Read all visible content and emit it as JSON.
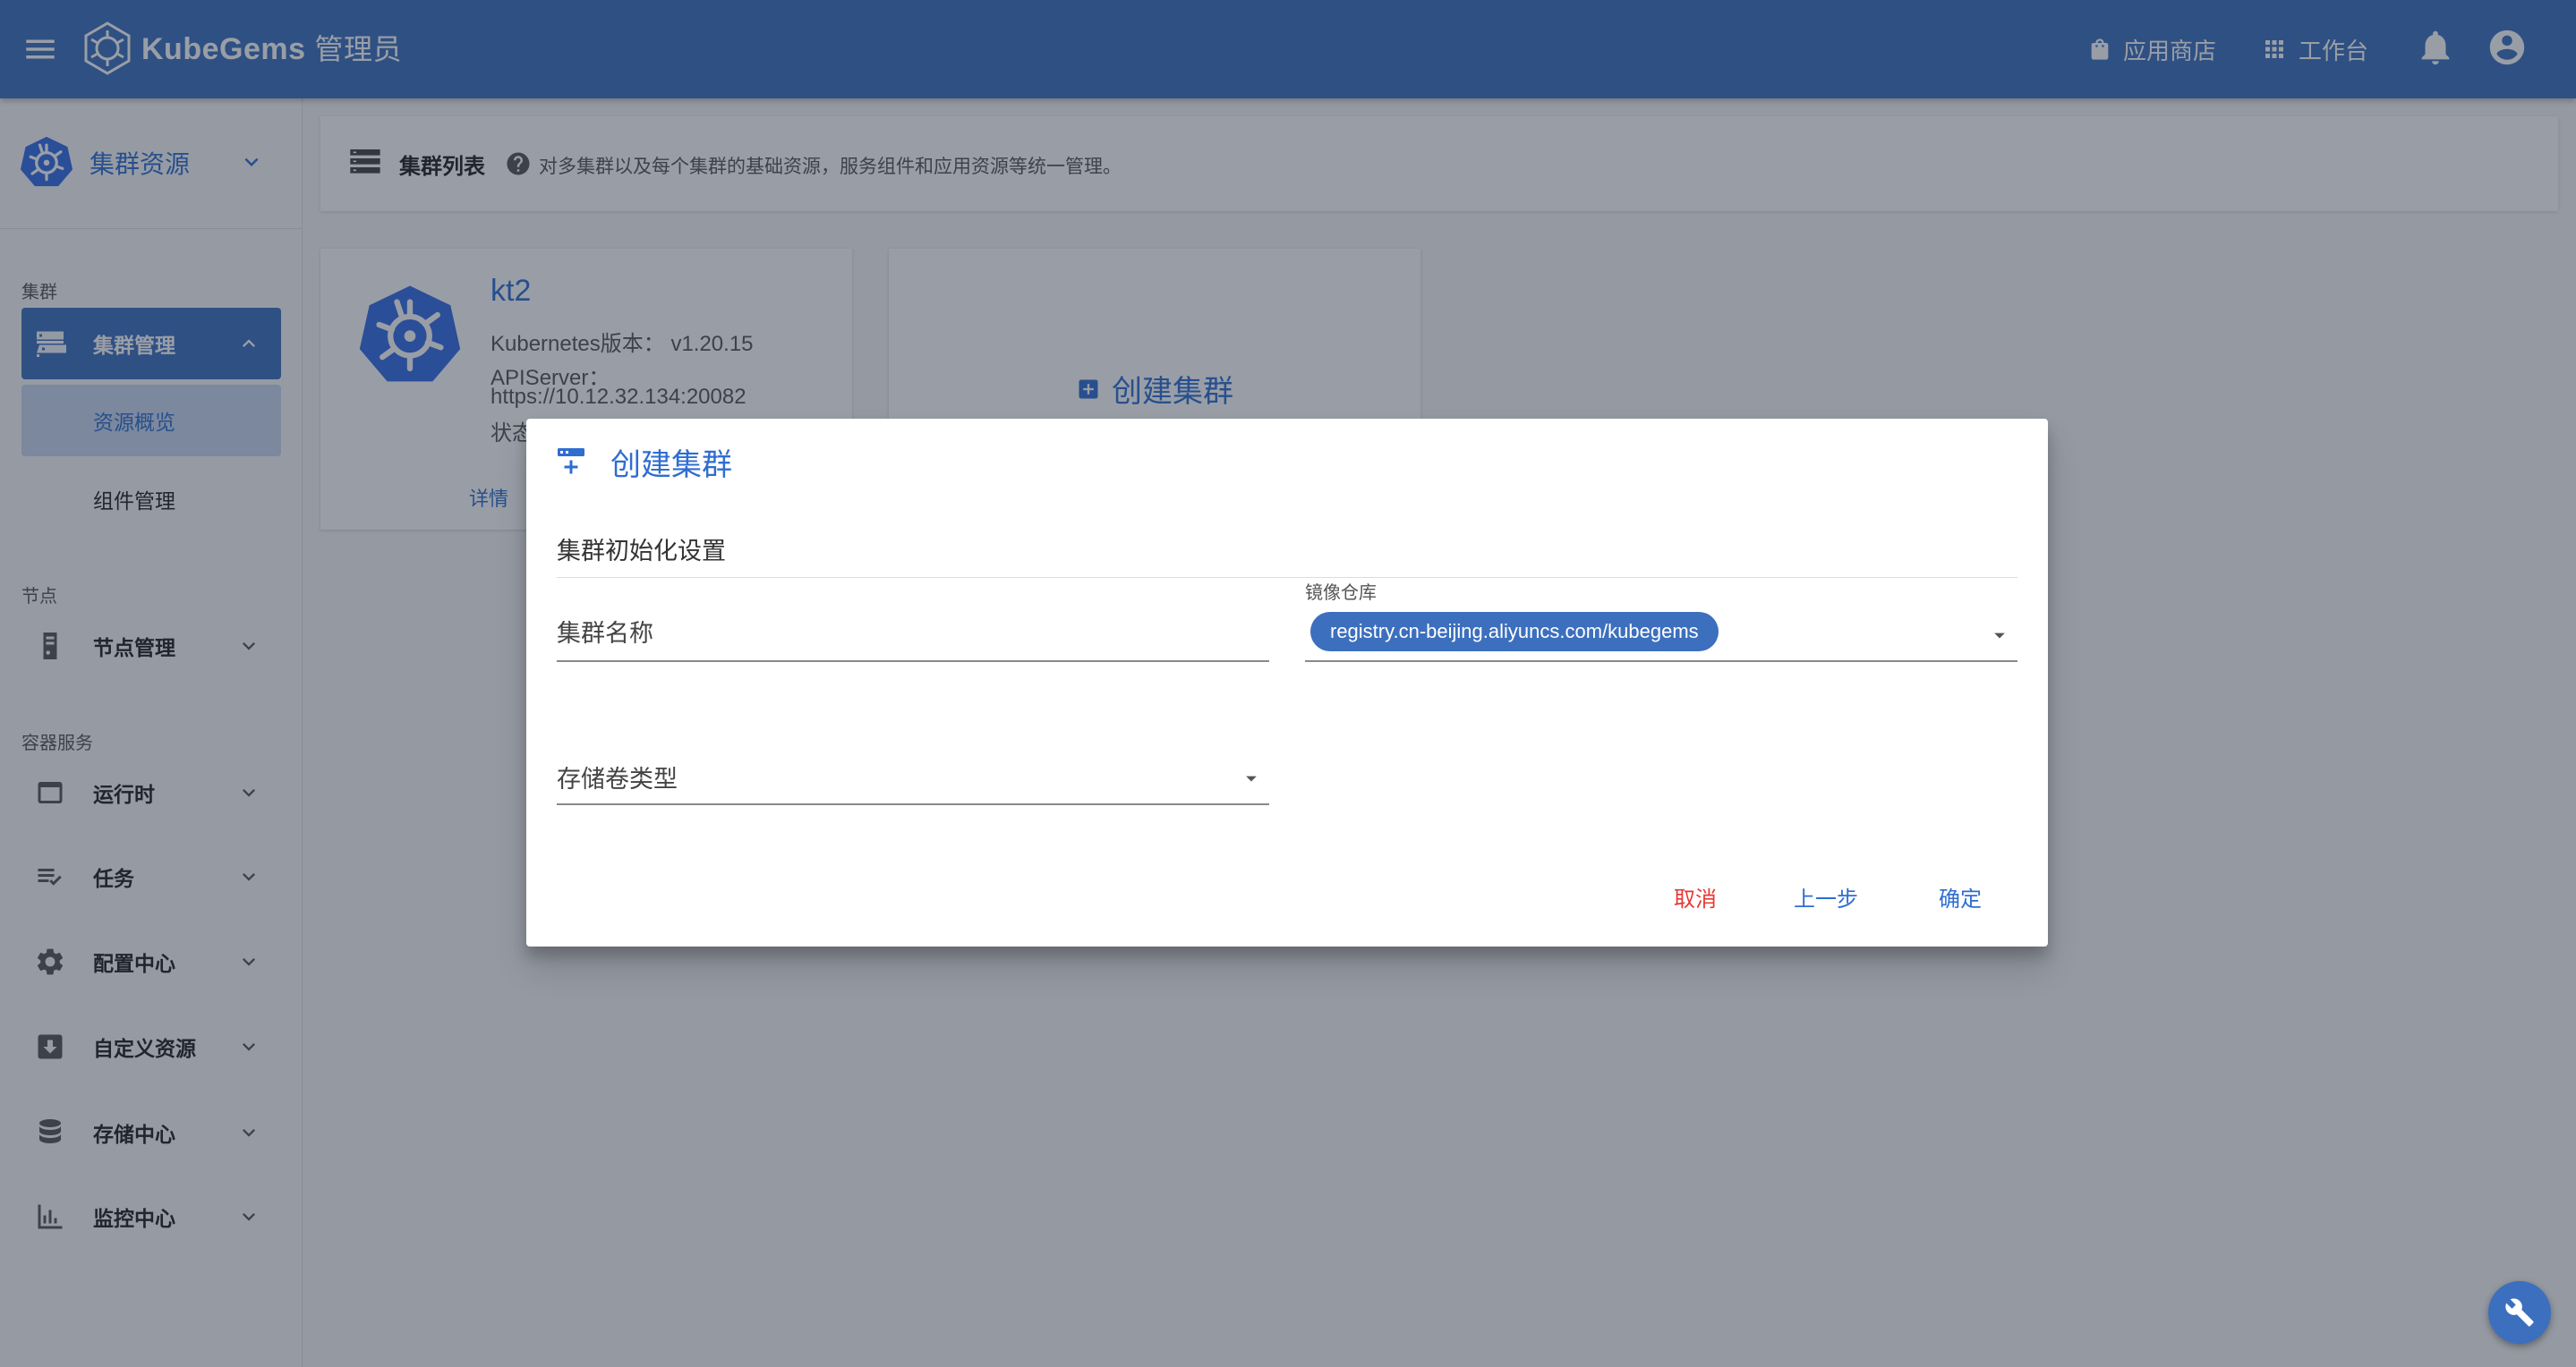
{
  "appbar": {
    "brand": "KubeGems",
    "role": "管理员",
    "app_store": "应用商店",
    "workspace": "工作台"
  },
  "sidebar": {
    "header_title": "集群资源",
    "groups": {
      "cluster": "集群",
      "node": "节点",
      "container": "容器服务"
    },
    "items": {
      "cluster_mgmt": "集群管理",
      "resource_overview": "资源概览",
      "component_mgmt": "组件管理",
      "node_mgmt": "节点管理",
      "runtime": "运行时",
      "tasks": "任务",
      "config_center": "配置中心",
      "custom_resources": "自定义资源",
      "storage_center": "存储中心",
      "monitor_center": "监控中心"
    }
  },
  "page": {
    "title": "集群列表",
    "description": "对多集群以及每个集群的基础资源，服务组件和应用资源等统一管理。"
  },
  "cluster_card": {
    "name": "kt2",
    "version_label": "Kubernetes版本：",
    "version": "v1.20.15",
    "apiserver_label": "APIServer：",
    "apiserver": "https://10.12.32.134:20082",
    "status_label": "状态",
    "detail": "详情"
  },
  "create_card": {
    "label": "创建集群"
  },
  "dialog": {
    "title": "创建集群",
    "section": "集群初始化设置",
    "cluster_name_placeholder": "集群名称",
    "registry_label": "镜像仓库",
    "registry_value": "registry.cn-beijing.aliyuncs.com/kubegems",
    "storage_class_placeholder": "存储卷类型",
    "cancel": "取消",
    "prev": "上一步",
    "confirm": "确定"
  },
  "colors": {
    "primary": "#3c6fbe",
    "link": "#2f6dd1",
    "danger": "#e53935"
  }
}
